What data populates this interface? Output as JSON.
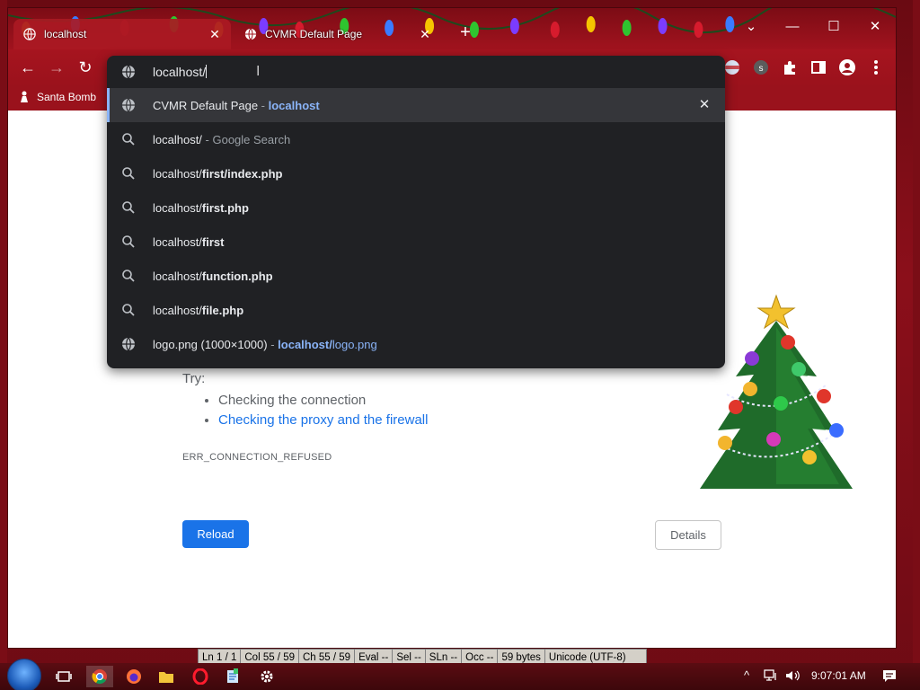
{
  "window": {
    "tabs": [
      {
        "title": "localhost",
        "active": true,
        "close": "✕"
      },
      {
        "title": "CVMR Default Page",
        "active": false,
        "close": "✕"
      }
    ],
    "new_tab": "+",
    "controls": {
      "chevron": "⌄",
      "minimize": "—",
      "maximize": "☐",
      "close": "✕"
    }
  },
  "toolbar": {
    "back": "←",
    "forward": "→",
    "reload": "↻",
    "extensions": [
      "flag-icon",
      "s-extension-icon",
      "puzzle-icon",
      "sidebar-icon",
      "profile-icon",
      "menu-icon"
    ]
  },
  "bookmarks": [
    {
      "label": "Santa Bomb",
      "icon": "person-icon"
    }
  ],
  "omnibox": {
    "input_text": "localhost/",
    "suggestions": [
      {
        "icon": "globe-icon",
        "text": "CVMR Default Page",
        "sep": " - ",
        "url": "localhost",
        "selected": true,
        "close": "✕"
      },
      {
        "icon": "search-icon",
        "base": "localhost/",
        "suffix": "",
        "sub": " - Google Search"
      },
      {
        "icon": "search-icon",
        "base": "localhost/",
        "suffix": "first/index.php"
      },
      {
        "icon": "search-icon",
        "base": "localhost/",
        "suffix": "first.php"
      },
      {
        "icon": "search-icon",
        "base": "localhost/",
        "suffix": "first"
      },
      {
        "icon": "search-icon",
        "base": "localhost/",
        "suffix": "function.php"
      },
      {
        "icon": "search-icon",
        "base": "localhost/",
        "suffix": "file.php"
      },
      {
        "icon": "globe-icon",
        "text": "logo.png (1000×1000)",
        "sep": " - ",
        "url_bold": "localhost/",
        "url_rest": "logo.png"
      }
    ]
  },
  "page": {
    "try_label": "Try:",
    "suggestions": [
      "Checking the connection",
      "Checking the proxy and the firewall"
    ],
    "error_code": "ERR_CONNECTION_REFUSED",
    "reload_label": "Reload",
    "details_label": "Details"
  },
  "statusbar": {
    "cells": [
      "Ln  1 / 1",
      "Col  55 / 59",
      "Ch  55 / 59",
      "Eval  --",
      "Sel  --",
      "SLn  --",
      "Occ  --",
      "59 bytes",
      "Unicode (UTF-8)"
    ]
  },
  "taskbar": {
    "clock": "9:07:01 AM",
    "apps": [
      "task-view-icon",
      "chrome-icon",
      "firefox-icon",
      "folder-icon",
      "opera-icon",
      "notepad-icon",
      "settings-icon"
    ]
  },
  "colors": {
    "accent_blue": "#1a73e8",
    "omnibox_bg": "#202124",
    "omnibox_selected": "#35363a",
    "link_blue": "#8ab4f8",
    "chrome_red": "#a3141f"
  }
}
